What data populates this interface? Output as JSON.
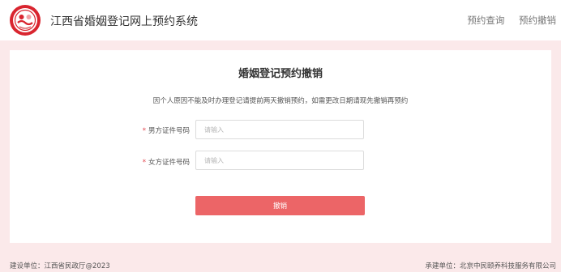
{
  "header": {
    "title": "江西省婚姻登记网上预约系统",
    "nav": [
      "预约查询",
      "预约撤销"
    ]
  },
  "form": {
    "title": "婚姻登记预约撤销",
    "notice": "因个人原因不能及时办理登记请提前两天撤销预约，如需更改日期请现先撤销再预约",
    "required_mark": "*",
    "male_id_label": "男方证件号码",
    "female_id_label": "女方证件号码",
    "placeholder": "请输入",
    "submit_label": "撤销"
  },
  "footer": {
    "left": "建设单位：江西省民政厅@2023",
    "right": "承建单位：北京中民颐养科技服务有限公司"
  },
  "colors": {
    "brand_red": "#d9252f",
    "button": "#ec6567",
    "page_bg": "#fbe9ea"
  }
}
